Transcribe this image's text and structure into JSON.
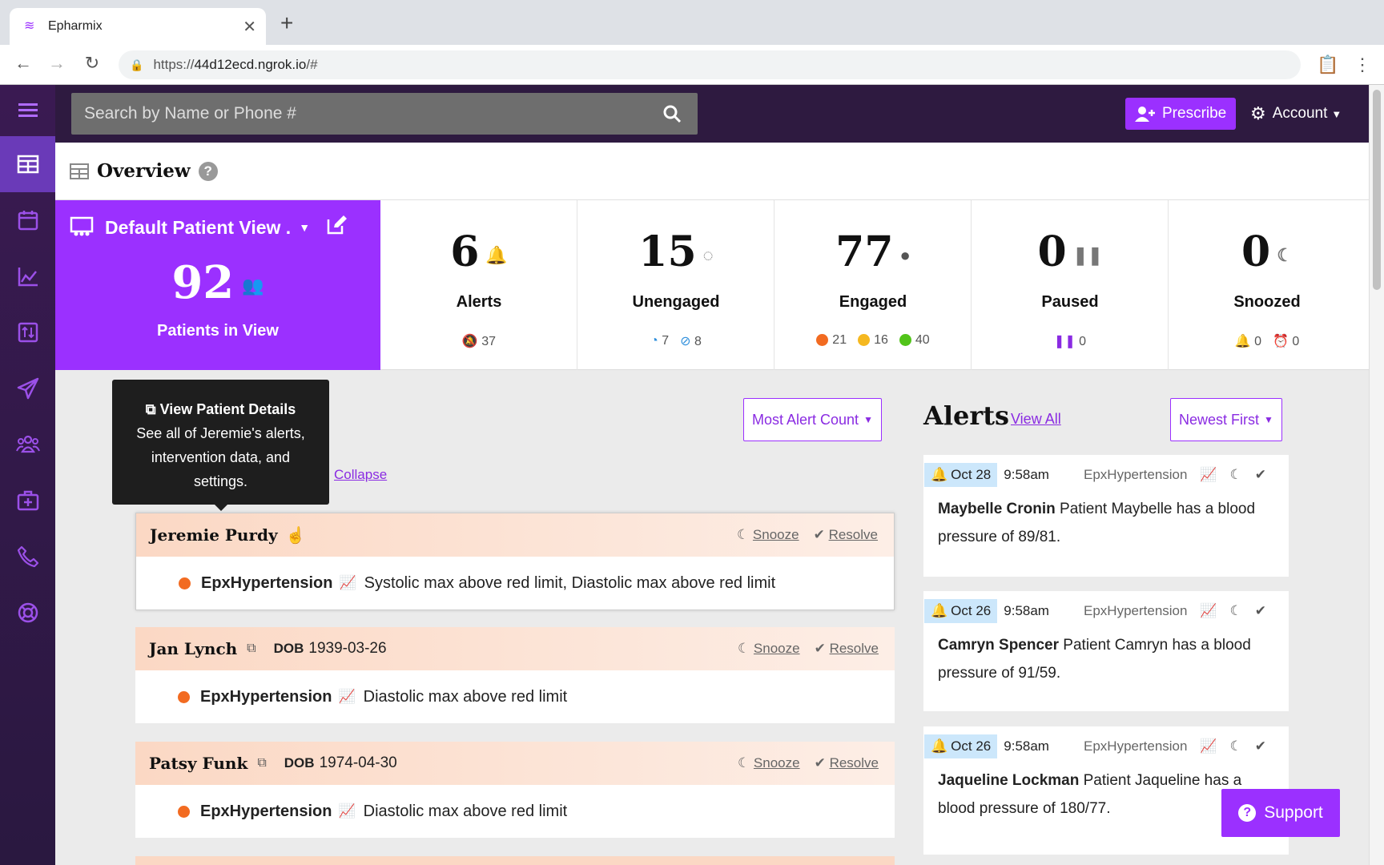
{
  "browser": {
    "tab_title": "Epharmix",
    "url_prefix": "https://",
    "url_host": "44d12ecd.ngrok.io",
    "url_path": "/#"
  },
  "topbar": {
    "search_placeholder": "Search by Name or Phone #",
    "prescribe_label": "Prescribe",
    "account_label": "Account"
  },
  "sidebar": {
    "items": [
      "grid-icon",
      "calendar-icon",
      "chart-icon",
      "transfer-icon",
      "send-icon",
      "users-icon",
      "medkit-icon",
      "phone-icon",
      "lifering-icon"
    ]
  },
  "overview": {
    "title": "Overview"
  },
  "patient_view": {
    "title": "Default Patient View .",
    "count": "92",
    "label": "Patients in View"
  },
  "stats": [
    {
      "num": "6",
      "label": "Alerts",
      "sub": [
        {
          "icon": "bell-slash",
          "value": "37"
        }
      ]
    },
    {
      "num": "15",
      "label": "Unengaged",
      "sub": [
        {
          "icon": "circle-notch",
          "value": "7"
        },
        {
          "icon": "ban",
          "value": "8"
        }
      ]
    },
    {
      "num": "77",
      "label": "Engaged",
      "sub": [
        {
          "color": "#f26b21",
          "value": "21"
        },
        {
          "color": "#f5b820",
          "value": "16"
        },
        {
          "color": "#52c41a",
          "value": "40"
        }
      ]
    },
    {
      "num": "0",
      "label": "Paused",
      "sub": [
        {
          "icon": "pause",
          "value": "0"
        }
      ]
    },
    {
      "num": "0",
      "label": "Snoozed",
      "sub": [
        {
          "icon": "bell",
          "value": "0"
        },
        {
          "icon": "alarm",
          "value": "0"
        }
      ]
    }
  ],
  "tooltip": {
    "title": "View Patient Details",
    "text": "See all of Jeremie's alerts, intervention data, and settings."
  },
  "collapse_label": "Collapse",
  "sort_patients": "Most Alert Count",
  "sort_alerts": "Newest First",
  "patients": [
    {
      "name": "Jeremie Purdy",
      "dob_label": "",
      "dob": "",
      "program": "EpxHypertension",
      "message": "Systolic max above red limit, Diastolic max above red limit"
    },
    {
      "name": "Jan Lynch",
      "dob_label": "DOB",
      "dob": "1939-03-26",
      "program": "EpxHypertension",
      "message": "Diastolic max above red limit"
    },
    {
      "name": "Patsy Funk",
      "dob_label": "DOB",
      "dob": "1974-04-30",
      "program": "EpxHypertension",
      "message": "Diastolic max above red limit"
    }
  ],
  "actions": {
    "snooze": "Snooze",
    "resolve": "Resolve"
  },
  "alerts_panel": {
    "title": "Alerts",
    "view_all": "View All"
  },
  "alerts": [
    {
      "date": "Oct 28",
      "time": "9:58am",
      "program": "EpxHypertension",
      "name": "Maybelle Cronin",
      "text": "Patient Maybelle has a blood pressure of 89/81."
    },
    {
      "date": "Oct 26",
      "time": "9:58am",
      "program": "EpxHypertension",
      "name": "Camryn Spencer",
      "text": "Patient Camryn has a blood pressure of 91/59."
    },
    {
      "date": "Oct 26",
      "time": "9:58am",
      "program": "EpxHypertension",
      "name": "Jaqueline Lockman",
      "text": "Patient Jaqueline has a blood pressure of 180/77."
    }
  ],
  "support_label": "Support",
  "colors": {
    "brand": "#9b30ff",
    "dark": "#2e1a40",
    "alert_orange": "#f26b21"
  }
}
